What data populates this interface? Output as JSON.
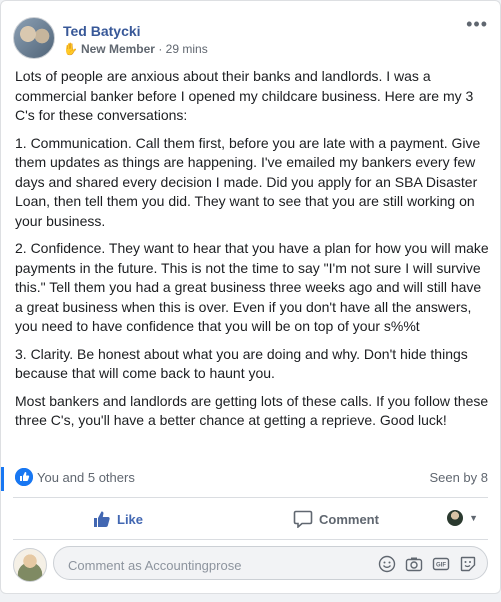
{
  "post": {
    "author": "Ted Batycki",
    "badge": "New Member",
    "badge_icon": "wave-hand-icon",
    "separator": "·",
    "time": "29 mins",
    "more": "•••",
    "paragraphs": [
      "Lots of people are anxious about their banks and landlords. I was a commercial banker before I opened my childcare business. Here are my 3 C's for these conversations:",
      "1. Communication. Call them first, before you are late with a payment. Give them updates as things are happening. I've emailed my bankers every few days and shared every decision I made. Did you apply for an SBA Disaster Loan, then tell them you did. They want to see that you are still working on your business.",
      "2. Confidence. They want to hear that you have a plan for how you will make payments in the future. This is not the time to say \"I'm not sure I will survive this.\" Tell them you had a great business three weeks ago and will still have a great business when this is over. Even if you don't have all the answers, you need to have confidence that you will be on top of your s%%t",
      "3. Clarity. Be honest about what you are doing and why. Don't hide things because that will come back to haunt you.",
      "Most bankers and landlords are getting lots of these calls. If you follow these three C's, you'll have a better chance at getting a reprieve. Good luck!"
    ]
  },
  "reactions": {
    "text": "You and 5 others",
    "seen": "Seen by 8",
    "like_color": "#1877f2"
  },
  "actions": {
    "like": "Like",
    "comment": "Comment"
  },
  "comment_box": {
    "placeholder": "Comment as Accountingprose"
  }
}
